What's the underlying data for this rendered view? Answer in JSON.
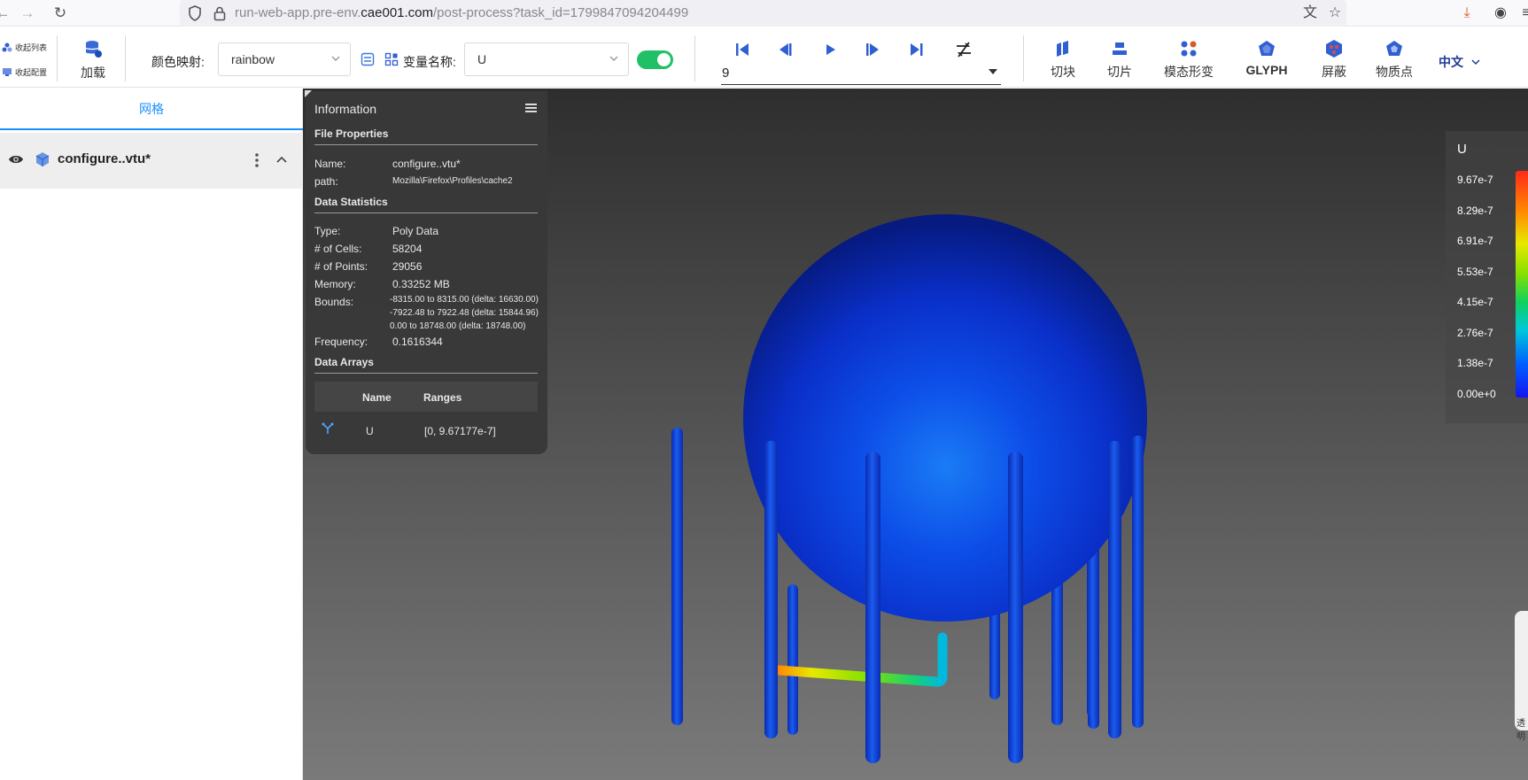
{
  "browser": {
    "url_prefix": "run-web-app.pre-env.",
    "url_domain": "cae001.com",
    "url_path": "/post-process?task_id=1799847094204499"
  },
  "toolbar": {
    "collapse_list": "收起列表",
    "collapse_config": "收起配置",
    "load": "加载",
    "color_map_label": "颜色映射:",
    "color_map_value": "rainbow",
    "variable_label": "变量名称:",
    "variable_value": "U",
    "frame_value": "9",
    "tools": [
      "切块",
      "切片",
      "模态形变",
      "GLYPH",
      "屏蔽",
      "物质点"
    ],
    "language": "中文"
  },
  "left_panel": {
    "tab": "网格",
    "tree_item": "configure..vtu*"
  },
  "info": {
    "title": "Information",
    "file_properties": "File Properties",
    "name_label": "Name:",
    "name_value": "configure..vtu*",
    "path_label": "path:",
    "path_value": "Mozilla\\Firefox\\Profiles\\cache2",
    "data_statistics": "Data Statistics",
    "type_label": "Type:",
    "type_value": "Poly Data",
    "cells_label": "# of Cells:",
    "cells_value": "58204",
    "points_label": "# of Points:",
    "points_value": "29056",
    "memory_label": "Memory:",
    "memory_value": "0.33252 MB",
    "bounds_label": "Bounds:",
    "bounds": [
      "-8315.00 to 8315.00 (delta: 16630.00)",
      "-7922.48 to 7922.48 (delta: 15844.96)",
      "0.00 to 18748.00 (delta: 18748.00)"
    ],
    "frequency_label": "Frequency:",
    "frequency_value": "0.1616344",
    "data_arrays": "Data Arrays",
    "arrays_col_name": "Name",
    "arrays_col_ranges": "Ranges",
    "array_name": "U",
    "array_range": "[0, 9.67177e-7]"
  },
  "legend": {
    "title": "U",
    "ticks": [
      "9.67e-7",
      "8.29e-7",
      "6.91e-7",
      "5.53e-7",
      "4.15e-7",
      "2.76e-7",
      "1.38e-7",
      "0.00e+0"
    ]
  },
  "edge_widget_text": "透明"
}
